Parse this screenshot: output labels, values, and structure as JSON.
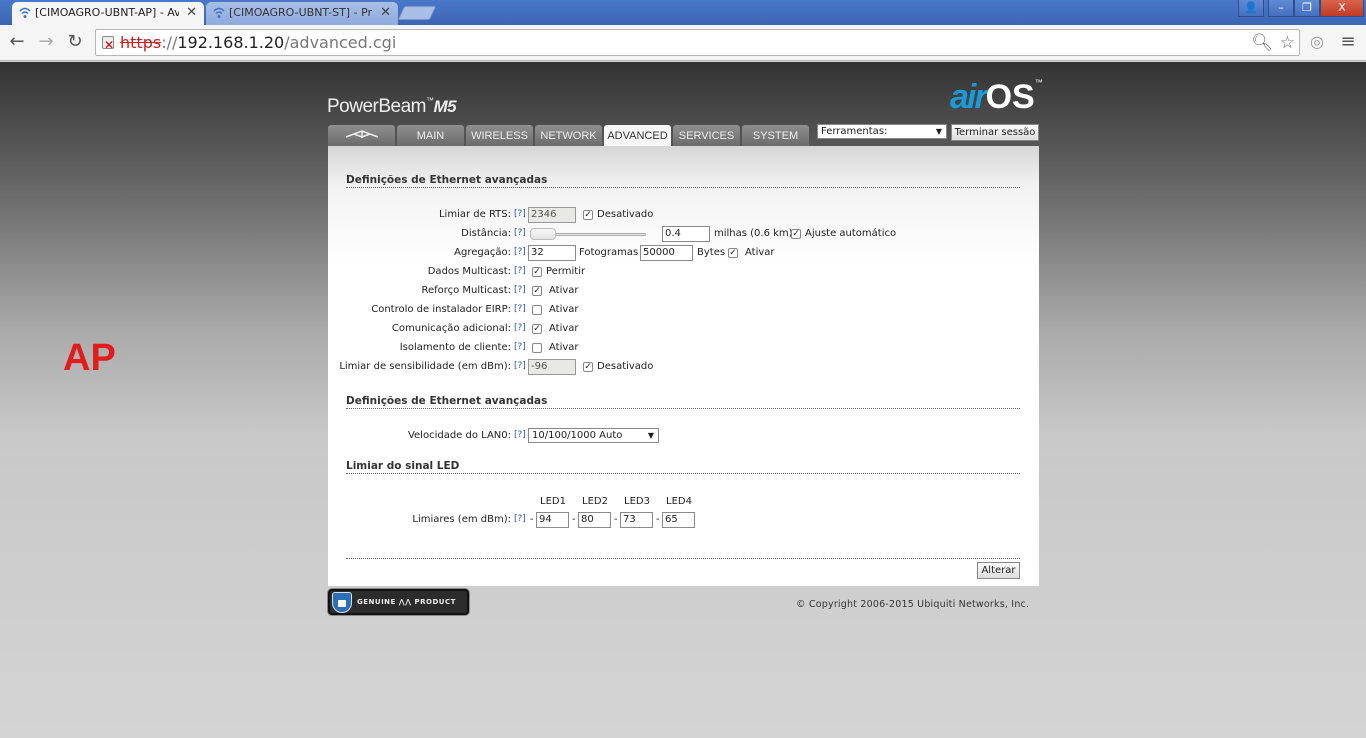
{
  "browser": {
    "tabs": [
      {
        "title": "[CIMOAGRO-UBNT-AP] - Ava",
        "active": true
      },
      {
        "title": "[CIMOAGRO-UBNT-ST] - Prin",
        "active": false
      }
    ],
    "window_buttons": {
      "user": "👤",
      "minimize": "–",
      "restore": "❐",
      "close": "X"
    },
    "url": {
      "scheme": "https",
      "sep": "://",
      "host": "192.168.1.20",
      "path": "/advanced.cgi"
    }
  },
  "side_label": "AP",
  "product": {
    "name": "PowerBeam",
    "tm": "™",
    "model": "M5"
  },
  "logo": {
    "air": "air",
    "os": "OS",
    "tm": "™"
  },
  "nav": {
    "tabs": [
      "MAIN",
      "WIRELESS",
      "NETWORK",
      "ADVANCED",
      "SERVICES",
      "SYSTEM"
    ],
    "active": "ADVANCED",
    "tools_select": "Ferramentas:",
    "logout": "Terminar sessão"
  },
  "help": "[?]",
  "section1": {
    "title": "Definições de Ethernet avançadas",
    "rts": {
      "label": "Limiar de RTS:",
      "value": "2346",
      "checkbox_label": "Desativado",
      "checked": true
    },
    "distance": {
      "label": "Distância:",
      "value": "0.4",
      "unit": "milhas (0.6 km)",
      "checkbox_label": "Ajuste automático",
      "checked": true
    },
    "aggregation": {
      "label": "Agregação:",
      "frames_value": "32",
      "frames_unit": "Fotogramas",
      "bytes_value": "50000",
      "bytes_unit": "Bytes",
      "checkbox_label": "Ativar",
      "checked": true
    },
    "multicast_data": {
      "label": "Dados Multicast:",
      "checkbox_label": "Permitir",
      "checked": true
    },
    "multicast_boost": {
      "label": "Reforço Multicast:",
      "checkbox_label": "Ativar",
      "checked": true
    },
    "eirp": {
      "label": "Controlo de instalador EIRP:",
      "checkbox_label": "Ativar",
      "checked": false
    },
    "extra_comm": {
      "label": "Comunicação adicional:",
      "checkbox_label": "Ativar",
      "checked": true
    },
    "client_isolation": {
      "label": "Isolamento de cliente:",
      "checkbox_label": "Ativar",
      "checked": false
    },
    "sensitivity": {
      "label": "Limiar de sensibilidade (em dBm):",
      "value": "-96",
      "checkbox_label": "Desativado",
      "checked": true
    }
  },
  "section2": {
    "title": "Definições de Ethernet avançadas",
    "lan_speed": {
      "label": "Velocidade do LAN0:",
      "value": "10/100/1000 Auto"
    }
  },
  "section3": {
    "title": "Limiar do sinal LED",
    "leds": [
      "LED1",
      "LED2",
      "LED3",
      "LED4"
    ],
    "thresholds_label": "Limiares (em dBm):",
    "dash": "-",
    "values": [
      "94",
      "80",
      "73",
      "65"
    ]
  },
  "apply": "Alterar",
  "genuine": "GENUINE ⋀⋀ PRODUCT",
  "copyright": "© Copyright 2006-2015 Ubiquiti Networks, Inc."
}
